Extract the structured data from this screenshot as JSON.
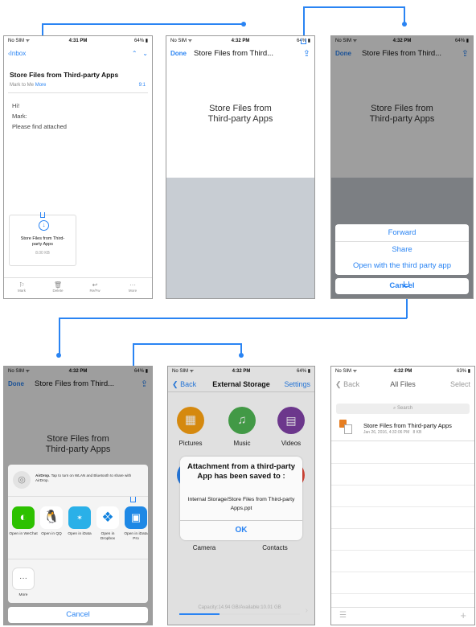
{
  "colors": {
    "accent": "#2a84f3",
    "dim_overlay": "rgba(0,0,0,0.38)"
  },
  "screen1": {
    "status": {
      "carrier": "No SIM ᯤ",
      "time": "4:31 PM",
      "battery": "64%"
    },
    "nav": {
      "back": "Inbox"
    },
    "subject": "Store Files from Third-party Apps",
    "from": "Mark",
    "to_prefix": "to Me",
    "more": "More",
    "date": "9:1",
    "body": [
      "Hi!",
      "Mark:",
      "Please find attached"
    ],
    "attachment": {
      "name": "Store Files from Third-party Apps",
      "size": "8.00 KB"
    },
    "toolbar": [
      {
        "label": "Mark",
        "icon": "flag-icon"
      },
      {
        "label": "Delete",
        "icon": "trash-icon"
      },
      {
        "label": "Re/Fw",
        "icon": "reply-icon"
      },
      {
        "label": "More",
        "icon": "more-icon"
      }
    ]
  },
  "screen2": {
    "status": {
      "carrier": "No SIM ᯤ",
      "time": "4:32 PM",
      "battery": "64%"
    },
    "nav": {
      "done": "Done",
      "title": "Store Files from Third..."
    },
    "preview_title": "Store Files from Third-party Apps"
  },
  "screen3": {
    "status": {
      "carrier": "No SIM ᯤ",
      "time": "4:32 PM",
      "battery": "64%"
    },
    "nav": {
      "done": "Done",
      "title": "Store Files from Third..."
    },
    "preview_title": "Store Files from Third-party Apps",
    "sheet": [
      "Forward",
      "Share",
      "Open with the third party app"
    ],
    "cancel": "Cancel"
  },
  "screen4": {
    "status": {
      "carrier": "No SIM ᯤ",
      "time": "4:32 PM",
      "battery": "64%"
    },
    "nav": {
      "done": "Done",
      "title": "Store Files from Third..."
    },
    "preview_title": "Store Files from Third-party Apps",
    "airdrop": {
      "label": "AirDrop.",
      "text": "Tap to turn on WLAN and Bluetooth to share with AirDrop."
    },
    "apps": [
      {
        "label": "Open in WeChat",
        "icon": "wechat-icon",
        "color": "#2dc100"
      },
      {
        "label": "Open in QQ",
        "icon": "qq-icon",
        "color": "#ffffff"
      },
      {
        "label": "Open in iData",
        "icon": "idata-icon",
        "color": "#2ab0e8"
      },
      {
        "label": "Open in Dropbox",
        "icon": "dropbox-icon",
        "color": "#ffffff"
      },
      {
        "label": "Open in iData Pro",
        "icon": "idata-pro-icon",
        "color": "#1e88e5"
      }
    ],
    "more": "More",
    "cancel": "Cancel"
  },
  "screen5": {
    "status": {
      "carrier": "No SIM ᯤ",
      "time": "4:32 PM",
      "battery": "64%"
    },
    "nav": {
      "back": "Back",
      "title": "External Storage",
      "settings": "Settings"
    },
    "grid": [
      {
        "label": "Pictures",
        "icon": "pictures-icon",
        "color": "#f39c12"
      },
      {
        "label": "Music",
        "icon": "music-icon",
        "color": "#4caf50"
      },
      {
        "label": "Videos",
        "icon": "videos-icon",
        "color": "#7b3fa0"
      }
    ],
    "grid_bottom": [
      {
        "label": "Camera"
      },
      {
        "label": "Contacts"
      }
    ],
    "dialog": {
      "title": "Attachment from a third-party App has been saved to :",
      "path": "Internal Storage/Store Files from Third-party Apps.ppt",
      "ok": "OK"
    },
    "capacity": "Capacity:14.94 GB/Available:10.01 GB"
  },
  "screen6": {
    "status": {
      "carrier": "No SIM ᯤ",
      "time": "4:32 PM",
      "battery": "63%"
    },
    "nav": {
      "back": "Back",
      "title": "All Files",
      "select": "Select"
    },
    "search": "Search",
    "file": {
      "name": "Store Files from Third-party Apps",
      "date": "Jan 26, 2016, 4:32:06 PM",
      "size": "8 KB"
    }
  }
}
